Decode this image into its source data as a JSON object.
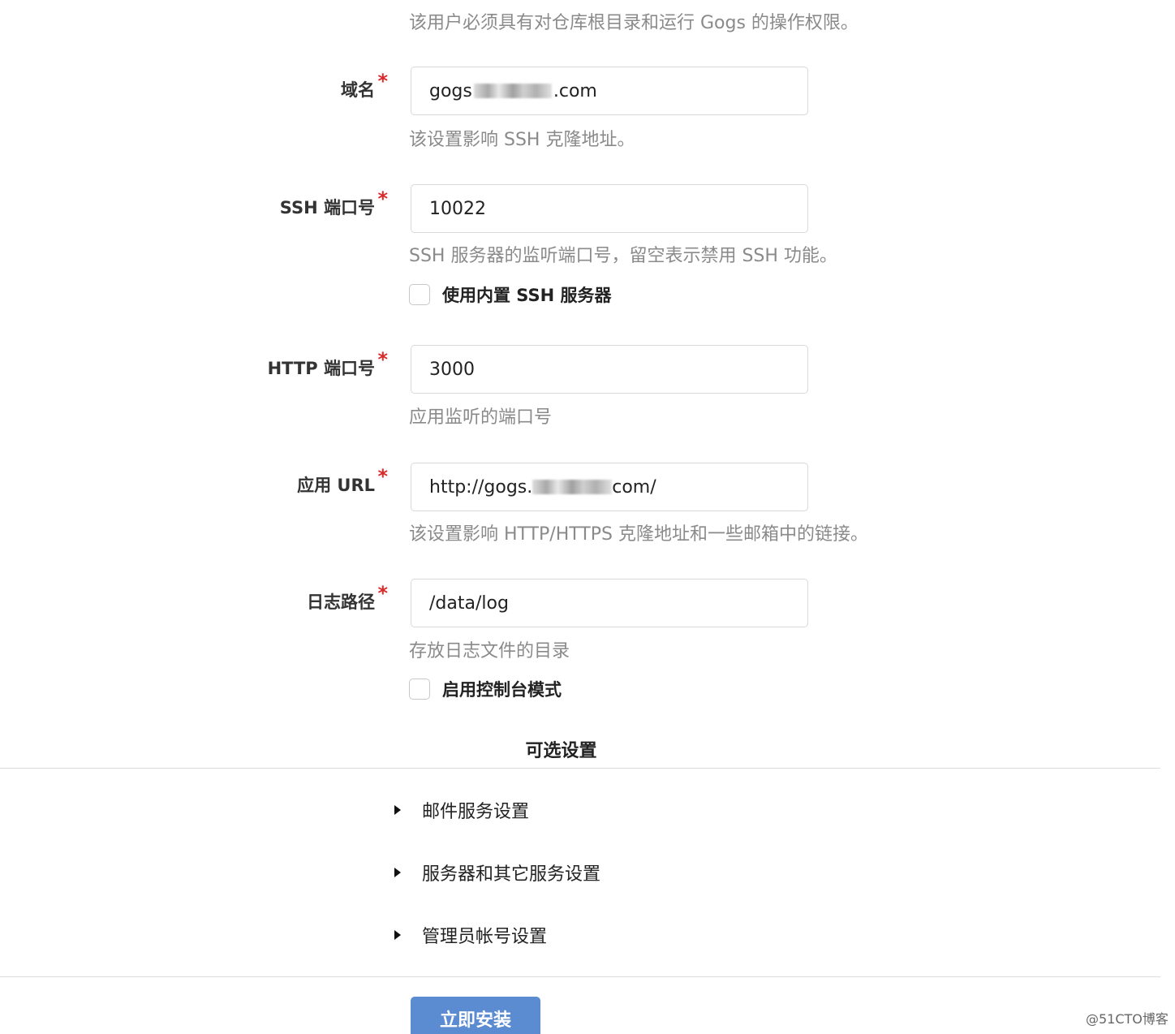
{
  "run_user_help": "该用户必须具有对仓库根目录和运行 Gogs 的操作权限。",
  "domain": {
    "label": "域名",
    "value_prefix": "gogs",
    "value_suffix": ".com",
    "help": "该设置影响 SSH 克隆地址。"
  },
  "ssh_port": {
    "label": "SSH 端口号",
    "value": "10022",
    "help": "SSH 服务器的监听端口号，留空表示禁用 SSH 功能。"
  },
  "builtin_ssh": {
    "label": "使用内置 SSH 服务器",
    "checked": false
  },
  "http_port": {
    "label": "HTTP 端口号",
    "value": "3000",
    "help": "应用监听的端口号"
  },
  "app_url": {
    "label": "应用 URL",
    "value_prefix": "http://gogs.",
    "value_suffix": "com/",
    "help": "该设置影响 HTTP/HTTPS 克隆地址和一些邮箱中的链接。"
  },
  "log_path": {
    "label": "日志路径",
    "value": "/data/log",
    "help": "存放日志文件的目录"
  },
  "console_mode": {
    "label": "启用控制台模式",
    "checked": false
  },
  "required_mark": "*",
  "optional_settings": {
    "title": "可选设置",
    "sections": [
      {
        "label": "邮件服务设置"
      },
      {
        "label": "服务器和其它服务设置"
      },
      {
        "label": "管理员帐号设置"
      }
    ]
  },
  "install_button": "立即安装",
  "watermark": "@51CTO博客",
  "colors": {
    "required": "#db2828",
    "primary_button": "#5b8bd0",
    "help_text": "#8a8a8a"
  }
}
